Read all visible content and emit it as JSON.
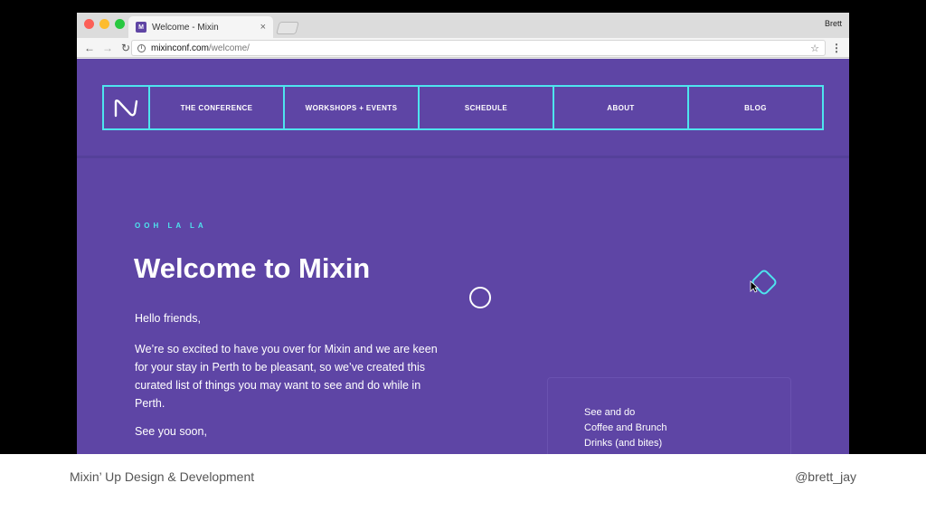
{
  "browser": {
    "tab_title": "Welcome - Mixin",
    "tab_favicon": "M",
    "tab_close": "×",
    "profile_name": "Brett",
    "url_host": "mixinconf.com",
    "url_path": "/welcome/"
  },
  "site": {
    "nav": [
      {
        "label": "THE CONFERENCE"
      },
      {
        "label": "WORKSHOPS + EVENTS"
      },
      {
        "label": "SCHEDULE"
      },
      {
        "label": "ABOUT"
      },
      {
        "label": "BLOG"
      }
    ],
    "eyebrow": "OOH LA LA",
    "title": "Welcome to Mixin",
    "greeting": "Hello friends,",
    "body": "We’re so excited to have you over for Mixin and we are keen for your stay in Perth to be pleasant, so we’ve created this curated list of things you may want to see and do while in Perth.",
    "signoff": "See you soon,",
    "card_items": [
      "See and do",
      "Coffee and Brunch",
      "Drinks (and bites)"
    ]
  },
  "slide_footer": {
    "left": "Mixin’ Up Design & Development",
    "right": "@brett_jay"
  },
  "colors": {
    "page_bg": "#5e45a5",
    "accent": "#4ee4ee",
    "traffic_red": "#fc5f57",
    "traffic_yellow": "#fdbc2e",
    "traffic_green": "#28c840"
  }
}
